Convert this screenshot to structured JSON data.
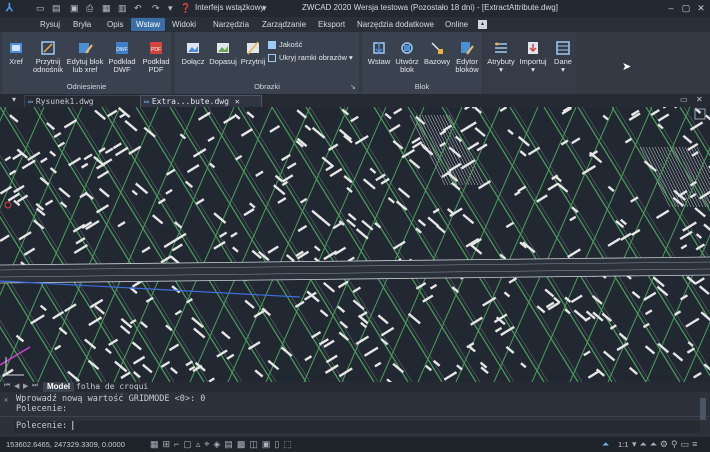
{
  "app": {
    "logo": "zwcad-logo",
    "search_label": "Interfejs wstążkowy",
    "title": "ZWCAD 2020 Wersja testowa (Pozostało 18 dni) - [ExtractAttribute.dwg]"
  },
  "menu_tabs": [
    "Rysuj",
    "Bryła",
    "Opis",
    "Wstaw",
    "Widoki",
    "Narzędzia",
    "Zarządzanie",
    "Eksport",
    "Narzędzia dodatkowe",
    "Online"
  ],
  "active_tab": "Wstaw",
  "ribbon": {
    "odniesienie": {
      "label": "Odniesienie",
      "buttons": [
        "Xref",
        "Przytnij odnośnik",
        "Edytuj blok lub xref",
        "Podkład DWF",
        "Podkład PDF"
      ]
    },
    "obrazki": {
      "label": "Obrazki",
      "buttons": [
        "Dołącz",
        "Dopasuj",
        "Przytnij"
      ],
      "small_buttons": [
        "Jakość",
        "Ukryj ramki obrazów"
      ]
    },
    "blok": {
      "label": "Blok",
      "buttons": [
        "Wstaw",
        "Utwórz blok",
        "Bazowy",
        "Edytor bloków"
      ]
    },
    "extra_buttons": [
      "Atrybuty",
      "Importuj",
      "Dane"
    ]
  },
  "doc_tabs": [
    "Rysunek1.dwg",
    "Extra...bute.dwg"
  ],
  "active_doc": "Extra...bute.dwg",
  "layout_tabs": [
    "Model",
    "folha de croqui"
  ],
  "command": {
    "history": [
      "Wprowadź nową wartość GRIDMODE  <0>: 0",
      "Polecenie:"
    ],
    "prompt": "Polecenie:"
  },
  "status": {
    "coordinates": "153602.6465, 247329.3309, 0.0000",
    "scale": "1:1"
  },
  "colors": {
    "accent": "#3b6ea5",
    "canvas": "#222831",
    "road_green": "#4aa05a",
    "building_white": "#e6e6e6"
  }
}
